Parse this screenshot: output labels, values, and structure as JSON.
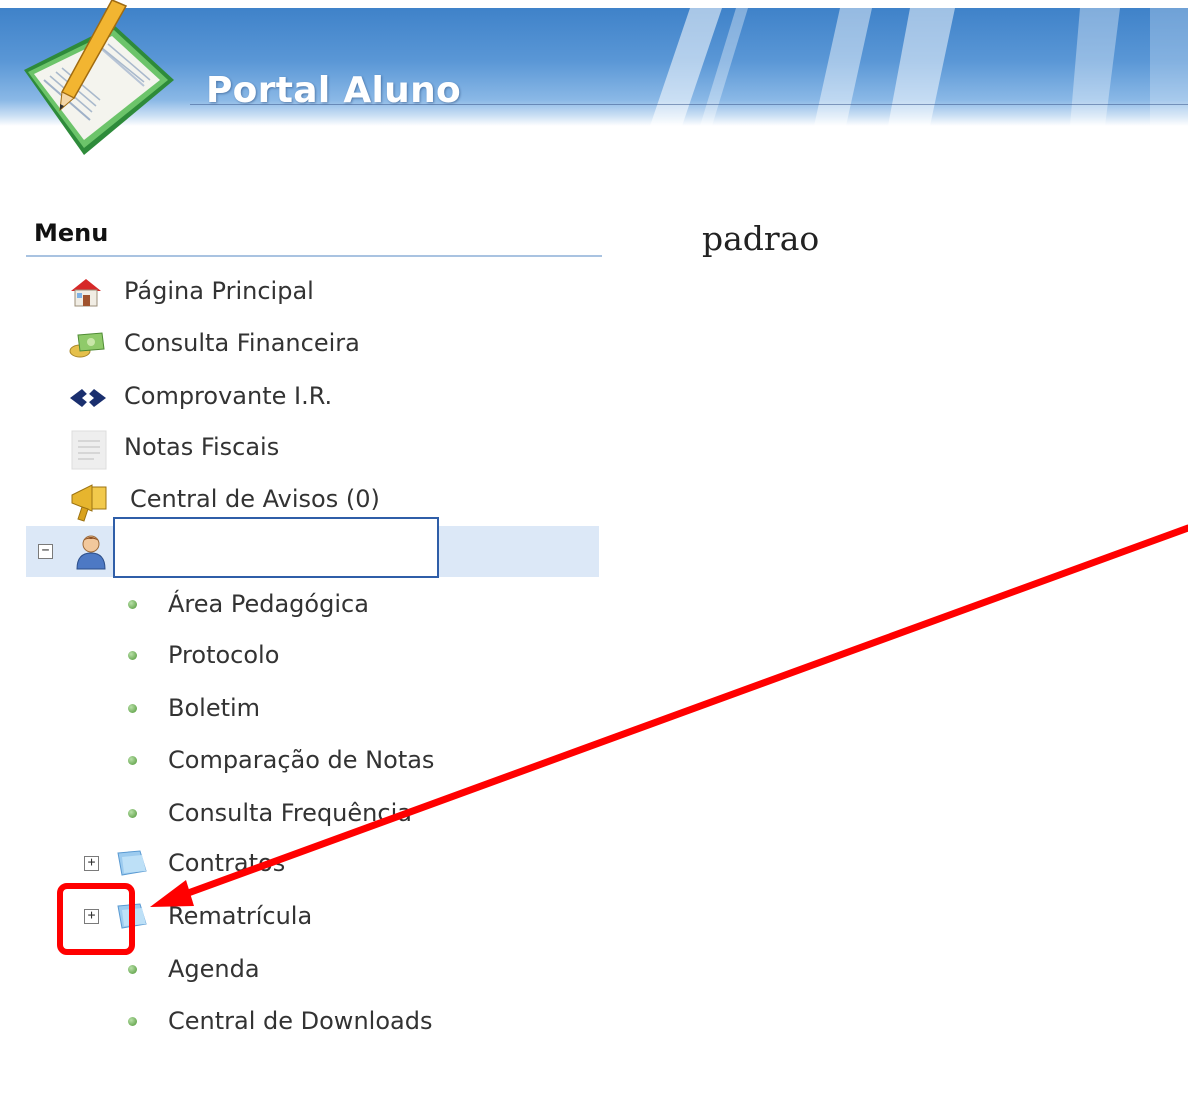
{
  "header": {
    "title": "Portal Aluno"
  },
  "menu": {
    "title": "Menu",
    "top_items": [
      {
        "label": "Página Principal",
        "icon": "house-icon"
      },
      {
        "label": "Consulta Financeira",
        "icon": "money-icon"
      },
      {
        "label": "Comprovante I.R.",
        "icon": "receita-icon"
      },
      {
        "label": "Notas Fiscais",
        "icon": "document-icon"
      },
      {
        "label": "Central de Avisos (0)",
        "icon": "megaphone-icon"
      }
    ],
    "user": {
      "name": "",
      "icon": "user-icon",
      "expander": "−"
    },
    "sub_items": [
      {
        "label": "Área Pedagógica"
      },
      {
        "label": "Protocolo"
      },
      {
        "label": "Boletim"
      },
      {
        "label": "Comparação de Notas"
      },
      {
        "label": "Consulta Frequência"
      },
      {
        "label": "Contratos",
        "expander": "+"
      },
      {
        "label": "Rematrícula",
        "expander": "+"
      },
      {
        "label": "Agenda"
      },
      {
        "label": "Central de Downloads"
      }
    ]
  },
  "content": {
    "text": "padrao"
  },
  "colors": {
    "header_blue": "#3f82c9",
    "selected_row": "#dce8f7",
    "annotation_red": "#ff0000",
    "bullet_green": "#6eac58"
  }
}
